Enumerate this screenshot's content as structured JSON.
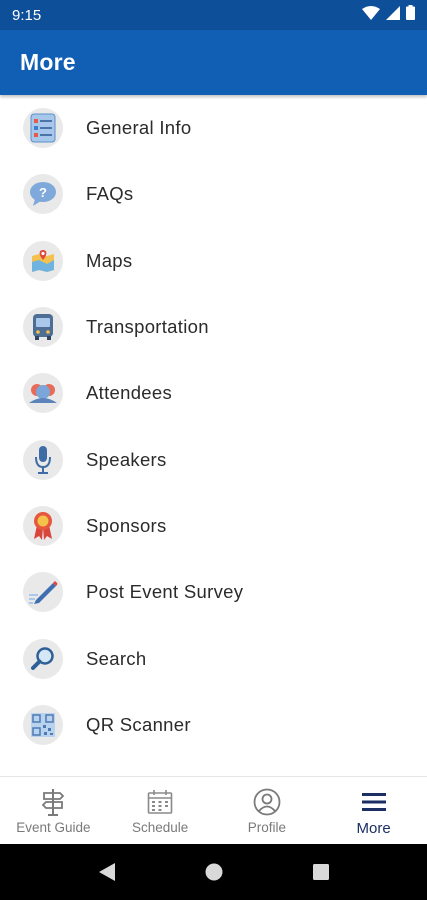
{
  "status_bar": {
    "time": "9:15"
  },
  "app_bar": {
    "title": "More"
  },
  "menu": {
    "items": [
      {
        "label": "General Info",
        "icon": "general-info-icon"
      },
      {
        "label": "FAQs",
        "icon": "faq-icon"
      },
      {
        "label": "Maps",
        "icon": "maps-icon"
      },
      {
        "label": "Transportation",
        "icon": "bus-icon"
      },
      {
        "label": "Attendees",
        "icon": "attendees-icon"
      },
      {
        "label": "Speakers",
        "icon": "microphone-icon"
      },
      {
        "label": "Sponsors",
        "icon": "ribbon-icon"
      },
      {
        "label": "Post Event Survey",
        "icon": "survey-pencil-icon"
      },
      {
        "label": "Search",
        "icon": "search-icon"
      },
      {
        "label": "QR Scanner",
        "icon": "qr-scanner-icon"
      }
    ]
  },
  "bottom_nav": {
    "items": [
      {
        "label": "Event Guide",
        "icon": "signpost-icon",
        "active": false
      },
      {
        "label": "Schedule",
        "icon": "calendar-icon",
        "active": false
      },
      {
        "label": "Profile",
        "icon": "profile-icon",
        "active": false
      },
      {
        "label": "More",
        "icon": "hamburger-menu-icon",
        "active": true
      }
    ]
  },
  "colors": {
    "status_bar": "#0d4f98",
    "app_bar": "#115fb5",
    "active_nav": "#1c2f63",
    "inactive_nav": "#7a7a7a"
  }
}
